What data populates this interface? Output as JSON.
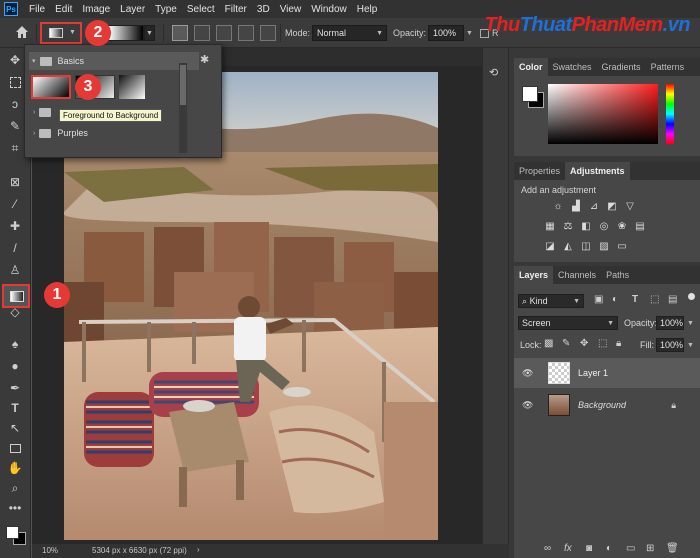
{
  "menu": {
    "logo": "Ps",
    "items": [
      "File",
      "Edit",
      "Image",
      "Layer",
      "Type",
      "Select",
      "Filter",
      "3D",
      "View",
      "Window",
      "Help"
    ]
  },
  "watermark": {
    "part_a": "Thu",
    "part_b": "Thuat",
    "part_c": "PhanMem",
    "part_d": ".vn"
  },
  "options": {
    "mode_label": "Mode:",
    "mode_value": "Normal",
    "opacity_label": "Opacity:",
    "opacity_value": "100%",
    "extra_label": "R"
  },
  "callouts": {
    "one": "1",
    "two": "2",
    "three": "3"
  },
  "gradient_picker": {
    "group_basics": "Basics",
    "tooltip": "Foreground to Background",
    "group_purples": "Purples"
  },
  "status": {
    "zoom": "10%",
    "size": "5304 px x 6630 px (72 ppi)"
  },
  "color_panel": {
    "tabs": [
      "Color",
      "Swatches",
      "Gradients",
      "Patterns"
    ],
    "active": 0
  },
  "adjust_panel": {
    "tabs": [
      "Properties",
      "Adjustments"
    ],
    "active": 1,
    "hint": "Add an adjustment"
  },
  "layers_panel": {
    "tabs": [
      "Layers",
      "Channels",
      "Paths"
    ],
    "active": 0,
    "kind_label": "Kind",
    "blend_mode": "Screen",
    "opacity_label": "Opacity:",
    "opacity_value": "100%",
    "lock_label": "Lock:",
    "fill_label": "Fill:",
    "fill_value": "100%",
    "layers": [
      {
        "name": "Layer 1"
      },
      {
        "name": "Background"
      }
    ]
  },
  "colors": {
    "accent_red": "#e53935",
    "ui_dark": "#323232"
  }
}
